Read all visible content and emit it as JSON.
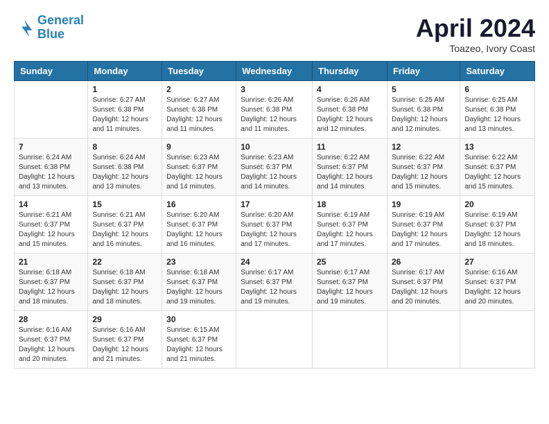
{
  "header": {
    "logo_line1": "General",
    "logo_line2": "Blue",
    "month": "April 2024",
    "location": "Toazeo, Ivory Coast"
  },
  "days_of_week": [
    "Sunday",
    "Monday",
    "Tuesday",
    "Wednesday",
    "Thursday",
    "Friday",
    "Saturday"
  ],
  "weeks": [
    [
      {
        "day": "",
        "info": ""
      },
      {
        "day": "1",
        "info": "Sunrise: 6:27 AM\nSunset: 6:38 PM\nDaylight: 12 hours\nand 11 minutes."
      },
      {
        "day": "2",
        "info": "Sunrise: 6:27 AM\nSunset: 6:38 PM\nDaylight: 12 hours\nand 11 minutes."
      },
      {
        "day": "3",
        "info": "Sunrise: 6:26 AM\nSunset: 6:38 PM\nDaylight: 12 hours\nand 11 minutes."
      },
      {
        "day": "4",
        "info": "Sunrise: 6:26 AM\nSunset: 6:38 PM\nDaylight: 12 hours\nand 12 minutes."
      },
      {
        "day": "5",
        "info": "Sunrise: 6:25 AM\nSunset: 6:38 PM\nDaylight: 12 hours\nand 12 minutes."
      },
      {
        "day": "6",
        "info": "Sunrise: 6:25 AM\nSunset: 6:38 PM\nDaylight: 12 hours\nand 13 minutes."
      }
    ],
    [
      {
        "day": "7",
        "info": "Sunrise: 6:24 AM\nSunset: 6:38 PM\nDaylight: 12 hours\nand 13 minutes."
      },
      {
        "day": "8",
        "info": "Sunrise: 6:24 AM\nSunset: 6:38 PM\nDaylight: 12 hours\nand 13 minutes."
      },
      {
        "day": "9",
        "info": "Sunrise: 6:23 AM\nSunset: 6:37 PM\nDaylight: 12 hours\nand 14 minutes."
      },
      {
        "day": "10",
        "info": "Sunrise: 6:23 AM\nSunset: 6:37 PM\nDaylight: 12 hours\nand 14 minutes."
      },
      {
        "day": "11",
        "info": "Sunrise: 6:22 AM\nSunset: 6:37 PM\nDaylight: 12 hours\nand 14 minutes."
      },
      {
        "day": "12",
        "info": "Sunrise: 6:22 AM\nSunset: 6:37 PM\nDaylight: 12 hours\nand 15 minutes."
      },
      {
        "day": "13",
        "info": "Sunrise: 6:22 AM\nSunset: 6:37 PM\nDaylight: 12 hours\nand 15 minutes."
      }
    ],
    [
      {
        "day": "14",
        "info": "Sunrise: 6:21 AM\nSunset: 6:37 PM\nDaylight: 12 hours\nand 15 minutes."
      },
      {
        "day": "15",
        "info": "Sunrise: 6:21 AM\nSunset: 6:37 PM\nDaylight: 12 hours\nand 16 minutes."
      },
      {
        "day": "16",
        "info": "Sunrise: 6:20 AM\nSunset: 6:37 PM\nDaylight: 12 hours\nand 16 minutes."
      },
      {
        "day": "17",
        "info": "Sunrise: 6:20 AM\nSunset: 6:37 PM\nDaylight: 12 hours\nand 17 minutes."
      },
      {
        "day": "18",
        "info": "Sunrise: 6:19 AM\nSunset: 6:37 PM\nDaylight: 12 hours\nand 17 minutes."
      },
      {
        "day": "19",
        "info": "Sunrise: 6:19 AM\nSunset: 6:37 PM\nDaylight: 12 hours\nand 17 minutes."
      },
      {
        "day": "20",
        "info": "Sunrise: 6:19 AM\nSunset: 6:37 PM\nDaylight: 12 hours\nand 18 minutes."
      }
    ],
    [
      {
        "day": "21",
        "info": "Sunrise: 6:18 AM\nSunset: 6:37 PM\nDaylight: 12 hours\nand 18 minutes."
      },
      {
        "day": "22",
        "info": "Sunrise: 6:18 AM\nSunset: 6:37 PM\nDaylight: 12 hours\nand 18 minutes."
      },
      {
        "day": "23",
        "info": "Sunrise: 6:18 AM\nSunset: 6:37 PM\nDaylight: 12 hours\nand 19 minutes."
      },
      {
        "day": "24",
        "info": "Sunrise: 6:17 AM\nSunset: 6:37 PM\nDaylight: 12 hours\nand 19 minutes."
      },
      {
        "day": "25",
        "info": "Sunrise: 6:17 AM\nSunset: 6:37 PM\nDaylight: 12 hours\nand 19 minutes."
      },
      {
        "day": "26",
        "info": "Sunrise: 6:17 AM\nSunset: 6:37 PM\nDaylight: 12 hours\nand 20 minutes."
      },
      {
        "day": "27",
        "info": "Sunrise: 6:16 AM\nSunset: 6:37 PM\nDaylight: 12 hours\nand 20 minutes."
      }
    ],
    [
      {
        "day": "28",
        "info": "Sunrise: 6:16 AM\nSunset: 6:37 PM\nDaylight: 12 hours\nand 20 minutes."
      },
      {
        "day": "29",
        "info": "Sunrise: 6:16 AM\nSunset: 6:37 PM\nDaylight: 12 hours\nand 21 minutes."
      },
      {
        "day": "30",
        "info": "Sunrise: 6:15 AM\nSunset: 6:37 PM\nDaylight: 12 hours\nand 21 minutes."
      },
      {
        "day": "",
        "info": ""
      },
      {
        "day": "",
        "info": ""
      },
      {
        "day": "",
        "info": ""
      },
      {
        "day": "",
        "info": ""
      }
    ]
  ]
}
